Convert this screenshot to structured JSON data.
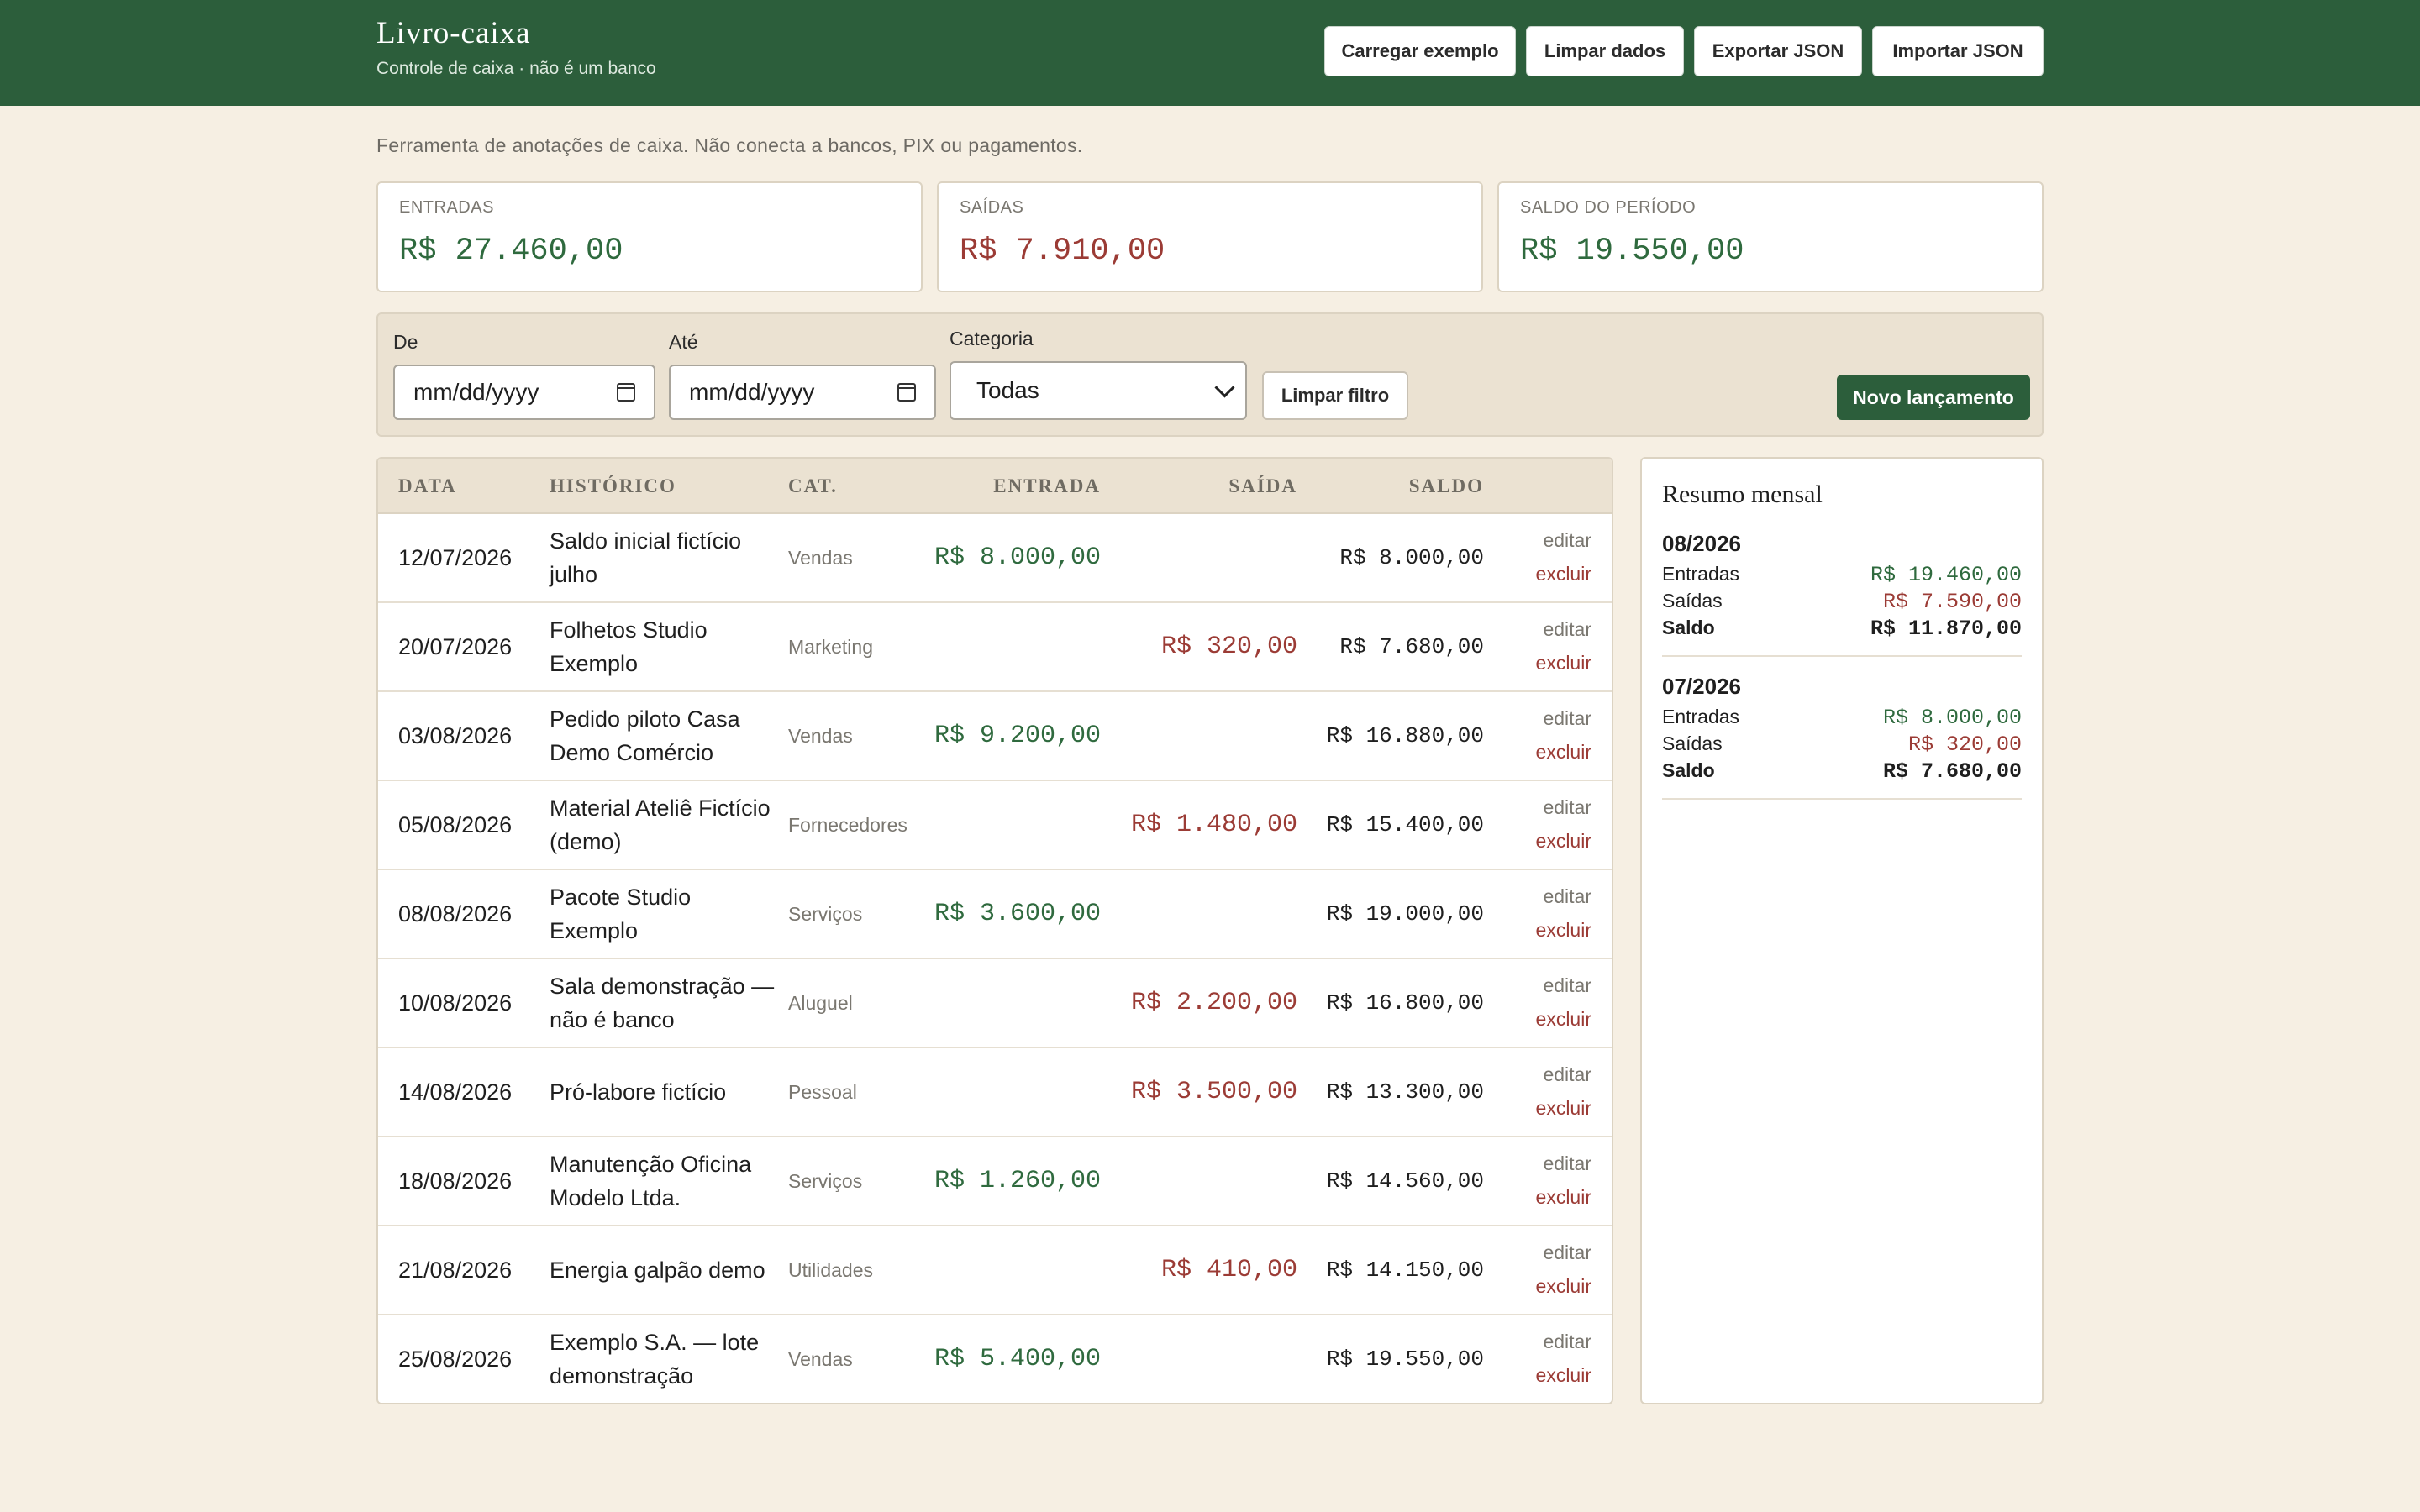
{
  "header": {
    "title": "Livro-caixa",
    "subtitle": "Controle de caixa · não é um banco",
    "buttons": [
      "Carregar exemplo",
      "Limpar dados",
      "Exportar JSON",
      "Importar JSON"
    ]
  },
  "disclaimer": "Ferramenta de anotações de caixa. Não conecta a bancos, PIX ou pagamentos.",
  "cards": [
    {
      "label": "ENTRADAS",
      "value": "R$ 27.460,00"
    },
    {
      "label": "SAÍDAS",
      "value": "R$ 7.910,00"
    },
    {
      "label": "SALDO DO PERÍODO",
      "value": "R$ 19.550,00"
    }
  ],
  "filters": {
    "from_label": "De",
    "to_label": "Até",
    "category_label": "Categoria",
    "date_placeholder": "mm/dd/yyyy",
    "category_value": "Todas",
    "clear_filter": "Limpar filtro",
    "new_entry": "Novo lançamento"
  },
  "table": {
    "columns": [
      "DATA",
      "HISTÓRICO",
      "CAT.",
      "ENTRADA",
      "SAÍDA",
      "SALDO"
    ],
    "edit_label": "editar",
    "delete_label": "excluir",
    "rows": [
      {
        "date": "12/07/2026",
        "history": "Saldo inicial fictício julho",
        "category": "Vendas",
        "in": "R$ 8.000,00",
        "out": "",
        "balance": "R$ 8.000,00"
      },
      {
        "date": "20/07/2026",
        "history": "Folhetos Studio Exemplo",
        "category": "Marketing",
        "in": "",
        "out": "R$ 320,00",
        "balance": "R$ 7.680,00"
      },
      {
        "date": "03/08/2026",
        "history": "Pedido piloto Casa Demo Comércio",
        "category": "Vendas",
        "in": "R$ 9.200,00",
        "out": "",
        "balance": "R$ 16.880,00"
      },
      {
        "date": "05/08/2026",
        "history": "Material Ateliê Fictício (demo)",
        "category": "Fornecedores",
        "in": "",
        "out": "R$ 1.480,00",
        "balance": "R$ 15.400,00"
      },
      {
        "date": "08/08/2026",
        "history": "Pacote Studio Exemplo",
        "category": "Serviços",
        "in": "R$ 3.600,00",
        "out": "",
        "balance": "R$ 19.000,00"
      },
      {
        "date": "10/08/2026",
        "history": "Sala demonstração — não é banco",
        "category": "Aluguel",
        "in": "",
        "out": "R$ 2.200,00",
        "balance": "R$ 16.800,00"
      },
      {
        "date": "14/08/2026",
        "history": "Pró-labore fictício",
        "category": "Pessoal",
        "in": "",
        "out": "R$ 3.500,00",
        "balance": "R$ 13.300,00"
      },
      {
        "date": "18/08/2026",
        "history": "Manutenção Oficina Modelo Ltda.",
        "category": "Serviços",
        "in": "R$ 1.260,00",
        "out": "",
        "balance": "R$ 14.560,00"
      },
      {
        "date": "21/08/2026",
        "history": "Energia galpão demo",
        "category": "Utilidades",
        "in": "",
        "out": "R$ 410,00",
        "balance": "R$ 14.150,00"
      },
      {
        "date": "25/08/2026",
        "history": "Exemplo S.A. — lote demonstração",
        "category": "Vendas",
        "in": "R$ 5.400,00",
        "out": "",
        "balance": "R$ 19.550,00"
      }
    ]
  },
  "summary": {
    "title": "Resumo mensal",
    "in_label": "Entradas",
    "out_label": "Saídas",
    "balance_label": "Saldo",
    "months": [
      {
        "month": "08/2026",
        "in": "R$ 19.460,00",
        "out": "R$ 7.590,00",
        "balance": "R$ 11.870,00"
      },
      {
        "month": "07/2026",
        "in": "R$ 8.000,00",
        "out": "R$ 320,00",
        "balance": "R$ 7.680,00"
      }
    ]
  },
  "colors": {
    "brand": "#2c5e3b",
    "background": "#f6efe3",
    "income": "#2f6a3e",
    "expense": "#9b3b35"
  }
}
